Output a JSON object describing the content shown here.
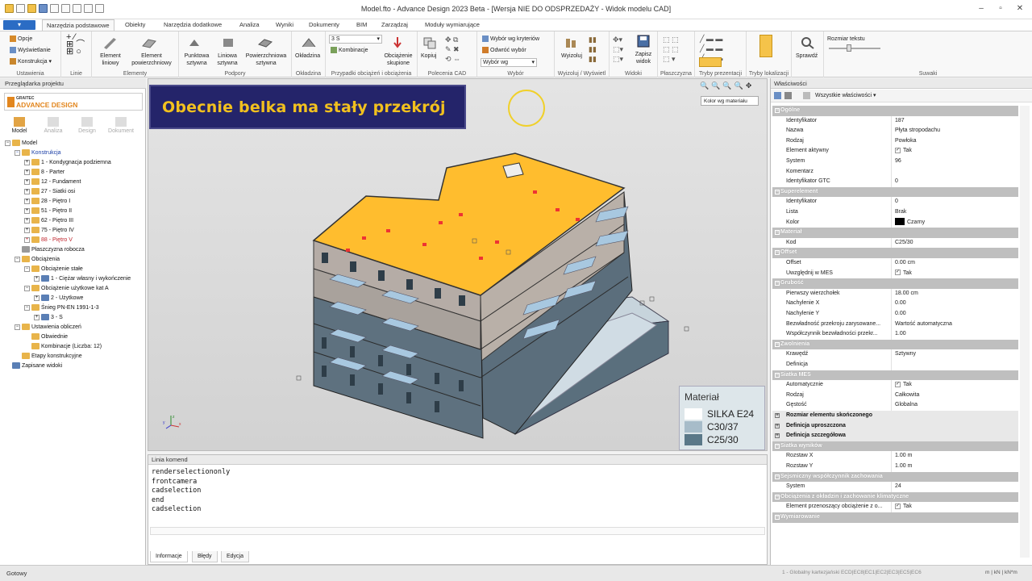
{
  "window": {
    "title": "Model.fto - Advance Design 2023 Beta - [Wersja NIE DO ODSPRZEDAŻY - Widok modelu CAD]"
  },
  "ribbon_tabs": {
    "file": "",
    "tabs": [
      "Narzędzia podstawowe",
      "Obiekty",
      "Narzędzia dodatkowe",
      "Analiza",
      "Wyniki",
      "Dokumenty",
      "BIM",
      "Zarządzaj",
      "Moduły wymiarujące"
    ],
    "active": "Narzędzia podstawowe"
  },
  "ribbon": {
    "ustawienia": {
      "opcje": "Opcje",
      "wyswietlanie": "Wyświetlanie",
      "konstrukcja": "Konstrukcja",
      "label": "Ustawienia"
    },
    "linie": {
      "label": "Linie"
    },
    "elementy": {
      "liniowy": "Element liniowy",
      "powierzchniowy": "Element powierzchniowy",
      "label": "Elementy"
    },
    "podpory": {
      "punktowa": "Punktowa sztywna",
      "liniowa": "Liniowa sztywna",
      "powierzchniowa": "Powierzchniowa sztywna",
      "label": "Podpory"
    },
    "okladzina": {
      "okladzina": "Okładzina",
      "label": "Okładzina"
    },
    "przypadki": {
      "combo_value": "3 S",
      "kombinacje": "Kombinacje",
      "obciazenie": "Obciążenie skupione",
      "label": "Przypadki obciążeń i obciążenia"
    },
    "cad": {
      "kopiuj": "Kopiuj",
      "label": "Polecenia CAD"
    },
    "wybor": {
      "kryteria": "Wybór wg kryteriów",
      "odwroc": "Odwróć wybór",
      "combo": "Wybór wg",
      "label": "Wybór"
    },
    "wyizoluj": {
      "wyizoluj": "Wyizoluj",
      "label": "Wyizoluj / Wyświetl"
    },
    "widoki": {
      "zapisz": "Zapisz widok",
      "label": "Widoki"
    },
    "plaszczyzna": {
      "label": "Płaszczyzna"
    },
    "tryby": {
      "label": "Tryby prezentacji"
    },
    "lokalizacji": {
      "label": "Tryby lokalizacji"
    },
    "sprawdz": {
      "label": "Sprawdź"
    },
    "suwaki": {
      "rozmiar": "Rozmiar tekstu",
      "label": "Suwaki"
    }
  },
  "left_panel": {
    "title": "Przeglądarka projektu",
    "logo_top": "GRAITEC",
    "logo_main": "ADVANCE DESIGN",
    "modes": [
      "Model",
      "Analiza",
      "Design",
      "Dokument"
    ],
    "tree": [
      {
        "label": "Model",
        "level": 0,
        "exp": "−",
        "icon": "yellow",
        "cls": ""
      },
      {
        "label": "Konstrukcja",
        "level": 1,
        "exp": "−",
        "icon": "yellow",
        "cls": "blu"
      },
      {
        "label": "1 - Kondygnacja podziemna",
        "level": 2,
        "exp": "+",
        "icon": "yellow",
        "cls": ""
      },
      {
        "label": "8 - Parter",
        "level": 2,
        "exp": "+",
        "icon": "yellow",
        "cls": ""
      },
      {
        "label": "12 - Fundament",
        "level": 2,
        "exp": "+",
        "icon": "yellow",
        "cls": ""
      },
      {
        "label": "27 - Siatki osi",
        "level": 2,
        "exp": "+",
        "icon": "yellow",
        "cls": ""
      },
      {
        "label": "28 - Piętro I",
        "level": 2,
        "exp": "+",
        "icon": "yellow",
        "cls": ""
      },
      {
        "label": "51 - Piętro II",
        "level": 2,
        "exp": "+",
        "icon": "yellow",
        "cls": ""
      },
      {
        "label": "62 - Piętro III",
        "level": 2,
        "exp": "+",
        "icon": "yellow",
        "cls": ""
      },
      {
        "label": "75 - Piętro IV",
        "level": 2,
        "exp": "+",
        "icon": "yellow",
        "cls": ""
      },
      {
        "label": "88 - Piętro V",
        "level": 2,
        "exp": "+",
        "icon": "yellow",
        "cls": "red"
      },
      {
        "label": "Płaszczyzna robocza",
        "level": 1,
        "exp": "",
        "icon": "grey",
        "cls": ""
      },
      {
        "label": "Obciążenia",
        "level": 1,
        "exp": "−",
        "icon": "yellow",
        "cls": ""
      },
      {
        "label": "Obciążenie stałe",
        "level": 2,
        "exp": "−",
        "icon": "yellow",
        "cls": ""
      },
      {
        "label": "1 - Ciężar własny i wykończenie",
        "level": 3,
        "exp": "+",
        "icon": "blue",
        "cls": ""
      },
      {
        "label": "Obciążenie użytkowe kat A",
        "level": 2,
        "exp": "−",
        "icon": "yellow",
        "cls": ""
      },
      {
        "label": "2 - Użytkowe",
        "level": 3,
        "exp": "+",
        "icon": "blue",
        "cls": ""
      },
      {
        "label": "Śnieg PN-EN 1991-1-3",
        "level": 2,
        "exp": "−",
        "icon": "yellow",
        "cls": ""
      },
      {
        "label": "3 - S",
        "level": 3,
        "exp": "+",
        "icon": "blue",
        "cls": ""
      },
      {
        "label": "Ustawienia obliczeń",
        "level": 1,
        "exp": "−",
        "icon": "yellow",
        "cls": ""
      },
      {
        "label": "Obwiednie",
        "level": 2,
        "exp": "",
        "icon": "yellow",
        "cls": ""
      },
      {
        "label": "Kombinacje (Liczba: 12)",
        "level": 2,
        "exp": "",
        "icon": "yellow",
        "cls": ""
      },
      {
        "label": "Etapy konstrukcyjne",
        "level": 1,
        "exp": "",
        "icon": "yellow",
        "cls": ""
      },
      {
        "label": "Zapisane widoki",
        "level": 0,
        "exp": "",
        "icon": "blue",
        "cls": ""
      }
    ]
  },
  "viewport": {
    "banner": "Obecnie belka ma stały przekrój",
    "color_mode": "Kolor wg materiału",
    "legend_title": "Materiał",
    "legend": [
      {
        "name": "SILKA E24",
        "color": "#ffffff"
      },
      {
        "name": "C30/37",
        "color": "#a7bcc9"
      },
      {
        "name": "C25/30",
        "color": "#5a7888"
      }
    ],
    "slab_color": "#ffbd2e",
    "axis_labels": {
      "x": "x",
      "y": "y",
      "z": "z"
    }
  },
  "command_line": {
    "title": "Linia komend",
    "lines": [
      "renderselectiononly",
      "frontcamera",
      "cadselection",
      "end",
      "cadselection"
    ],
    "tabs": [
      "Informacje",
      "Błędy",
      "Edycja"
    ]
  },
  "properties": {
    "title": "Właściwości",
    "filter": "Wszystkie właściwości",
    "rows": [
      {
        "type": "cat",
        "k": "Ogólne"
      },
      {
        "k": "Identyfikator",
        "v": "187"
      },
      {
        "k": "Nazwa",
        "v": "Płyta stropodachu"
      },
      {
        "k": "Rodzaj",
        "v": "Powłoka"
      },
      {
        "k": "Element aktywny",
        "v": "Tak",
        "check": true
      },
      {
        "k": "System",
        "v": "96"
      },
      {
        "k": "Komentarz",
        "v": ""
      },
      {
        "k": "Identyfikator GTC",
        "v": "0"
      },
      {
        "type": "cat",
        "k": "Superelement"
      },
      {
        "k": "Identyfikator",
        "v": "0"
      },
      {
        "k": "Lista",
        "v": "Brak"
      },
      {
        "k": "Kolor",
        "v": "Czarny",
        "color": true
      },
      {
        "type": "cat",
        "k": "Materiał"
      },
      {
        "k": "Kod",
        "v": "C25/30"
      },
      {
        "type": "cat",
        "k": "Offset"
      },
      {
        "k": "Offset",
        "v": "0.00 cm"
      },
      {
        "k": "Uwzględnij w MES",
        "v": "Tak",
        "check": true
      },
      {
        "type": "cat",
        "k": "Grubość"
      },
      {
        "k": "Pierwszy wierzchołek",
        "v": "18.00 cm"
      },
      {
        "k": "Nachylenie X",
        "v": "0.00"
      },
      {
        "k": "Nachylenie Y",
        "v": "0.00"
      },
      {
        "k": "Bezwładność przekroju zarysowane...",
        "v": "Wartość automatyczna"
      },
      {
        "k": "Współczynnik bezwładności przekr...",
        "v": "1.00"
      },
      {
        "type": "cat",
        "k": "Zwolnienia"
      },
      {
        "k": "Krawędź",
        "v": "Sztywny"
      },
      {
        "k": "Definicja",
        "v": ""
      },
      {
        "type": "cat",
        "k": "Siatka MES"
      },
      {
        "k": "Automatycznie",
        "v": "Tak",
        "check": true
      },
      {
        "k": "Rodzaj",
        "v": "Całkowita"
      },
      {
        "k": "Gęstość",
        "v": "Globalna"
      },
      {
        "type": "sub",
        "k": "Rozmiar elementu skończonego"
      },
      {
        "type": "sub",
        "k": "Definicja uproszczona"
      },
      {
        "type": "sub",
        "k": "Definicja szczegółowa"
      },
      {
        "type": "cat",
        "k": "Siatka wyników"
      },
      {
        "k": "Rozstaw X",
        "v": "1.00 m"
      },
      {
        "k": "Rozstaw Y",
        "v": "1.00 m"
      },
      {
        "type": "cat",
        "k": "Sejsmiczny współczynnik zachowania"
      },
      {
        "k": "System",
        "v": "24"
      },
      {
        "type": "cat",
        "k": "Obciążenia z okładzin i zachowanie klimatyczne"
      },
      {
        "k": "Element przenoszący obciążenie z o...",
        "v": "Tak",
        "check": true
      },
      {
        "type": "cat",
        "k": "Wymiarowanie"
      }
    ]
  },
  "status_bar": {
    "status": "Gotowy",
    "coords": "1 - Globalny kartezjański ECD|EC8|EC1|EC2|EC3|EC5|EC6",
    "units": "m | kN | kN*m"
  }
}
